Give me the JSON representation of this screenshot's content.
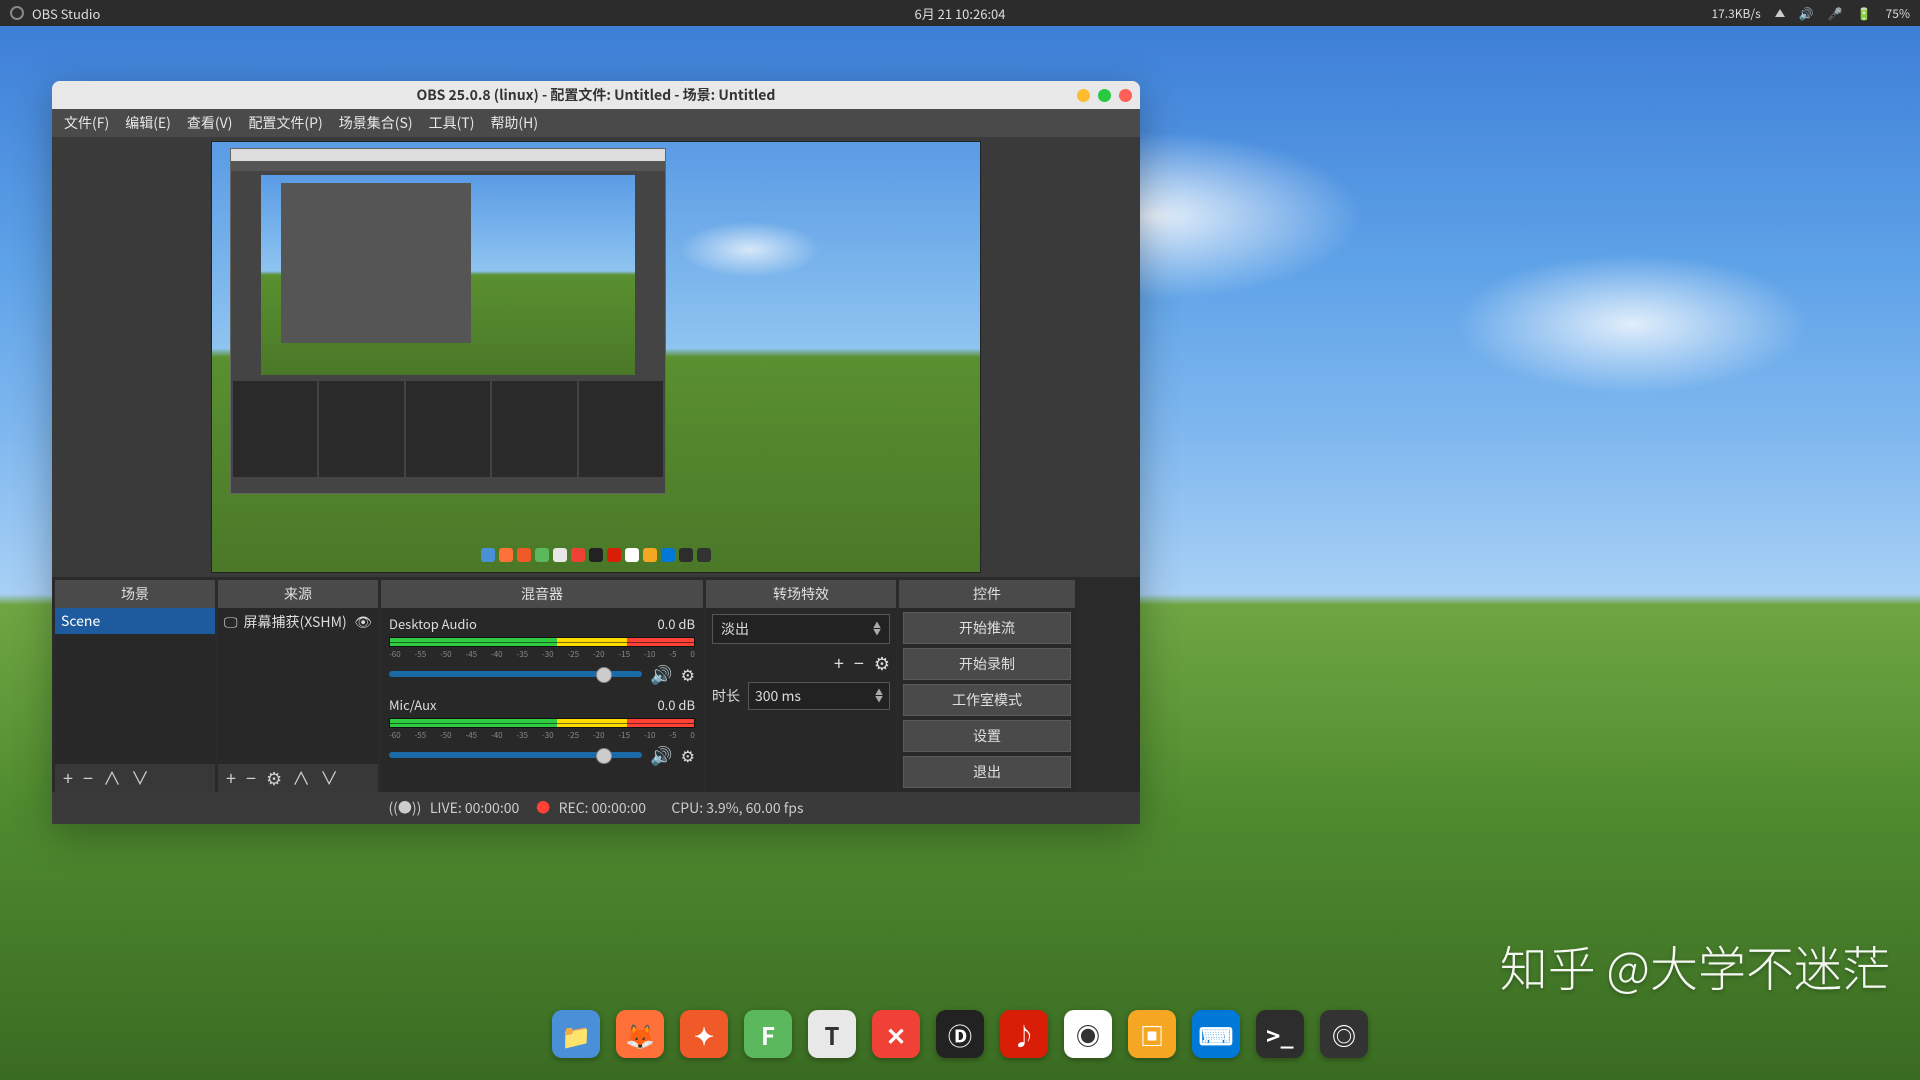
{
  "topbar": {
    "app_name": "OBS Studio",
    "datetime": "6月 21 10:26:04",
    "net_speed": "17.3KB/s",
    "battery": "75%"
  },
  "window": {
    "title": "OBS 25.0.8 (linux) - 配置文件: Untitled - 场景: Untitled"
  },
  "menus": {
    "file": "文件(F)",
    "edit": "编辑(E)",
    "view": "查看(V)",
    "profile": "配置文件(P)",
    "scene_collection": "场景集合(S)",
    "tools": "工具(T)",
    "help": "帮助(H)"
  },
  "panels": {
    "scenes": {
      "title": "场景",
      "items": [
        "Scene"
      ]
    },
    "sources": {
      "title": "来源",
      "items": [
        {
          "label": "屏幕捕获(XSHM)"
        }
      ]
    },
    "mixer": {
      "title": "混音器",
      "tracks": [
        {
          "name": "Desktop Audio",
          "level": "0.0 dB"
        },
        {
          "name": "Mic/Aux",
          "level": "0.0 dB"
        }
      ],
      "ticks": [
        "-60",
        "-55",
        "-50",
        "-45",
        "-40",
        "-35",
        "-30",
        "-25",
        "-20",
        "-15",
        "-10",
        "-5",
        "0"
      ]
    },
    "transitions": {
      "title": "转场特效",
      "current": "淡出",
      "duration_label": "时长",
      "duration_value": "300 ms"
    },
    "controls": {
      "title": "控件",
      "buttons": {
        "start_stream": "开始推流",
        "start_record": "开始录制",
        "studio_mode": "工作室模式",
        "settings": "设置",
        "exit": "退出"
      }
    }
  },
  "status": {
    "live": "LIVE: 00:00:00",
    "rec": "REC: 00:00:00",
    "cpu": "CPU: 3.9%, 60.00 fps"
  },
  "dock": {
    "items": [
      {
        "name": "files",
        "color": "#4a90d9",
        "glyph": "📁"
      },
      {
        "name": "firefox",
        "color": "#ff7139",
        "glyph": "🦊"
      },
      {
        "name": "app-orange",
        "color": "#f05a28",
        "glyph": "✦"
      },
      {
        "name": "app-green",
        "color": "#5cb85c",
        "glyph": "F"
      },
      {
        "name": "text",
        "color": "#e8e8e8",
        "glyph": "T"
      },
      {
        "name": "xmind",
        "color": "#ef4136",
        "glyph": "✕"
      },
      {
        "name": "dev",
        "color": "#222",
        "glyph": "Ⓓ"
      },
      {
        "name": "netease",
        "color": "#d81e06",
        "glyph": "♪"
      },
      {
        "name": "chrome",
        "color": "#fff",
        "glyph": "◉"
      },
      {
        "name": "vm",
        "color": "#f5a623",
        "glyph": "▣"
      },
      {
        "name": "vscode",
        "color": "#0078d7",
        "glyph": "⌨"
      },
      {
        "name": "terminal",
        "color": "#2d2d2d",
        "glyph": ">_"
      },
      {
        "name": "obs",
        "color": "#333",
        "glyph": "◎"
      }
    ]
  },
  "watermark": "知乎 @大学不迷茫"
}
